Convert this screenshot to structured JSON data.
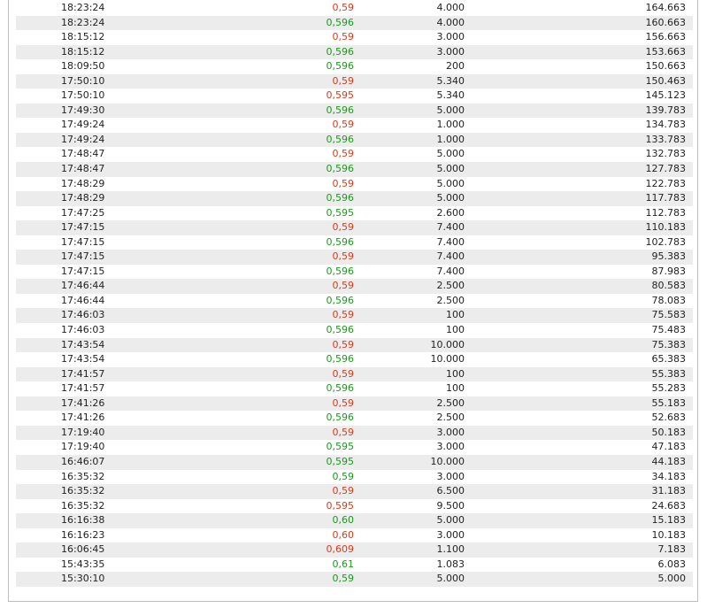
{
  "colors": {
    "price_up": "#1a9a1a",
    "price_down": "#d93a1a",
    "row_alt_bg": "#ececec",
    "border": "#bdbdbd"
  },
  "trades": {
    "rows": [
      {
        "time": "18:23:24",
        "price": "0,59",
        "direction": "down",
        "quantity": "4.000",
        "total": "164.663"
      },
      {
        "time": "18:23:24",
        "price": "0,596",
        "direction": "up",
        "quantity": "4.000",
        "total": "160.663"
      },
      {
        "time": "18:15:12",
        "price": "0,59",
        "direction": "down",
        "quantity": "3.000",
        "total": "156.663"
      },
      {
        "time": "18:15:12",
        "price": "0,596",
        "direction": "up",
        "quantity": "3.000",
        "total": "153.663"
      },
      {
        "time": "18:09:50",
        "price": "0,596",
        "direction": "up",
        "quantity": "200",
        "total": "150.663"
      },
      {
        "time": "17:50:10",
        "price": "0,59",
        "direction": "down",
        "quantity": "5.340",
        "total": "150.463"
      },
      {
        "time": "17:50:10",
        "price": "0,595",
        "direction": "down",
        "quantity": "5.340",
        "total": "145.123"
      },
      {
        "time": "17:49:30",
        "price": "0,596",
        "direction": "up",
        "quantity": "5.000",
        "total": "139.783"
      },
      {
        "time": "17:49:24",
        "price": "0,59",
        "direction": "down",
        "quantity": "1.000",
        "total": "134.783"
      },
      {
        "time": "17:49:24",
        "price": "0,596",
        "direction": "up",
        "quantity": "1.000",
        "total": "133.783"
      },
      {
        "time": "17:48:47",
        "price": "0,59",
        "direction": "down",
        "quantity": "5.000",
        "total": "132.783"
      },
      {
        "time": "17:48:47",
        "price": "0,596",
        "direction": "up",
        "quantity": "5.000",
        "total": "127.783"
      },
      {
        "time": "17:48:29",
        "price": "0,59",
        "direction": "down",
        "quantity": "5.000",
        "total": "122.783"
      },
      {
        "time": "17:48:29",
        "price": "0,596",
        "direction": "up",
        "quantity": "5.000",
        "total": "117.783"
      },
      {
        "time": "17:47:25",
        "price": "0,595",
        "direction": "up",
        "quantity": "2.600",
        "total": "112.783"
      },
      {
        "time": "17:47:15",
        "price": "0,59",
        "direction": "down",
        "quantity": "7.400",
        "total": "110.183"
      },
      {
        "time": "17:47:15",
        "price": "0,596",
        "direction": "up",
        "quantity": "7.400",
        "total": "102.783"
      },
      {
        "time": "17:47:15",
        "price": "0,59",
        "direction": "down",
        "quantity": "7.400",
        "total": "95.383"
      },
      {
        "time": "17:47:15",
        "price": "0,596",
        "direction": "up",
        "quantity": "7.400",
        "total": "87.983"
      },
      {
        "time": "17:46:44",
        "price": "0,59",
        "direction": "down",
        "quantity": "2.500",
        "total": "80.583"
      },
      {
        "time": "17:46:44",
        "price": "0,596",
        "direction": "up",
        "quantity": "2.500",
        "total": "78.083"
      },
      {
        "time": "17:46:03",
        "price": "0,59",
        "direction": "down",
        "quantity": "100",
        "total": "75.583"
      },
      {
        "time": "17:46:03",
        "price": "0,596",
        "direction": "up",
        "quantity": "100",
        "total": "75.483"
      },
      {
        "time": "17:43:54",
        "price": "0,59",
        "direction": "down",
        "quantity": "10.000",
        "total": "75.383"
      },
      {
        "time": "17:43:54",
        "price": "0,596",
        "direction": "up",
        "quantity": "10.000",
        "total": "65.383"
      },
      {
        "time": "17:41:57",
        "price": "0,59",
        "direction": "down",
        "quantity": "100",
        "total": "55.383"
      },
      {
        "time": "17:41:57",
        "price": "0,596",
        "direction": "up",
        "quantity": "100",
        "total": "55.283"
      },
      {
        "time": "17:41:26",
        "price": "0,59",
        "direction": "down",
        "quantity": "2.500",
        "total": "55.183"
      },
      {
        "time": "17:41:26",
        "price": "0,596",
        "direction": "up",
        "quantity": "2.500",
        "total": "52.683"
      },
      {
        "time": "17:19:40",
        "price": "0,59",
        "direction": "down",
        "quantity": "3.000",
        "total": "50.183"
      },
      {
        "time": "17:19:40",
        "price": "0,595",
        "direction": "up",
        "quantity": "3.000",
        "total": "47.183"
      },
      {
        "time": "16:46:07",
        "price": "0,595",
        "direction": "up",
        "quantity": "10.000",
        "total": "44.183"
      },
      {
        "time": "16:35:32",
        "price": "0,59",
        "direction": "up",
        "quantity": "3.000",
        "total": "34.183"
      },
      {
        "time": "16:35:32",
        "price": "0,59",
        "direction": "down",
        "quantity": "6.500",
        "total": "31.183"
      },
      {
        "time": "16:35:32",
        "price": "0,595",
        "direction": "down",
        "quantity": "9.500",
        "total": "24.683"
      },
      {
        "time": "16:16:38",
        "price": "0,60",
        "direction": "up",
        "quantity": "5.000",
        "total": "15.183"
      },
      {
        "time": "16:16:23",
        "price": "0,60",
        "direction": "down",
        "quantity": "3.000",
        "total": "10.183"
      },
      {
        "time": "16:06:45",
        "price": "0,609",
        "direction": "down",
        "quantity": "1.100",
        "total": "7.183"
      },
      {
        "time": "15:43:35",
        "price": "0,61",
        "direction": "up",
        "quantity": "1.083",
        "total": "6.083"
      },
      {
        "time": "15:30:10",
        "price": "0,59",
        "direction": "up",
        "quantity": "5.000",
        "total": "5.000"
      }
    ]
  }
}
